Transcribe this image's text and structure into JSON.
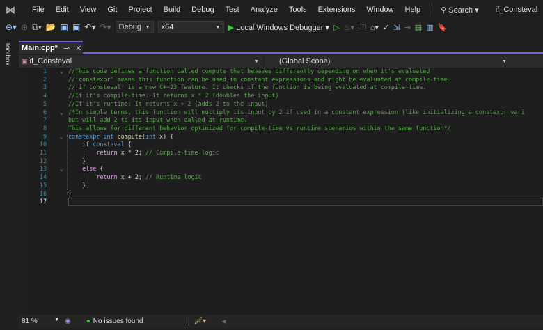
{
  "menu": {
    "items": [
      "File",
      "Edit",
      "View",
      "Git",
      "Project",
      "Build",
      "Debug",
      "Test",
      "Analyze",
      "Tools",
      "Extensions",
      "Window",
      "Help"
    ],
    "search": "Search",
    "solution": "if_Consteval"
  },
  "toolbar": {
    "config": "Debug",
    "platform": "x64",
    "debugger": "Local Windows Debugger"
  },
  "toolbox": {
    "label": "Toolbox"
  },
  "tab": {
    "label": "Main.cpp*"
  },
  "nav": {
    "project": "if_Consteval",
    "scope": "(Global Scope)"
  },
  "colors": {
    "comment": "#57a64a",
    "keyword": "#569cd6",
    "control": "#d8a0df",
    "function": "#dcdcaa",
    "plain": "#dcdcdc",
    "accent": "#7160e8"
  },
  "editor": {
    "current_line": 17,
    "lines": [
      {
        "n": "1",
        "fold": true,
        "tokens": [
          {
            "t": "//This code defines a function called compute that behaves differently depending on when it's evaluated",
            "c": "comment"
          }
        ]
      },
      {
        "n": "2",
        "tokens": [
          {
            "t": "//'constexpr' means this function can be used in constant expressions and might be evaluated at compile-time.",
            "c": "comment"
          }
        ]
      },
      {
        "n": "3",
        "tokens": [
          {
            "t": "//'if consteval' is a new C++23 feature. It checks if the function is being evaluated at compile-time.",
            "c": "comment"
          }
        ]
      },
      {
        "n": "4",
        "tokens": [
          {
            "t": "//If it's compile-time: It returns x * 2 (doubles the input)",
            "c": "comment"
          }
        ]
      },
      {
        "n": "5",
        "tokens": [
          {
            "t": "//If it's runtime: It returns x + 2 (adds 2 to the input)",
            "c": "comment"
          }
        ]
      },
      {
        "n": "6",
        "fold": true,
        "tokens": [
          {
            "t": "/*In simple terms, this function will multiply its input by 2 if used in a constant expression (like initializing a constexpr vari",
            "c": "comment"
          }
        ]
      },
      {
        "n": "7",
        "tokens": [
          {
            "t": "but will add 2 to its input when called at runtime.",
            "c": "comment"
          }
        ]
      },
      {
        "n": "8",
        "tokens": [
          {
            "t": "This allows for different behavior optimized for compile-time vs runtime scenarios within the same function*/",
            "c": "comment"
          }
        ]
      },
      {
        "n": "9",
        "fold": true,
        "tokens": [
          {
            "t": "constexpr int ",
            "c": "keyword"
          },
          {
            "t": "compute",
            "c": "function"
          },
          {
            "t": "(",
            "c": "plain"
          },
          {
            "t": "int",
            "c": "keyword"
          },
          {
            "t": " x) {",
            "c": "plain"
          }
        ]
      },
      {
        "n": "10",
        "tokens": [
          {
            "t": "    ",
            "c": "plain"
          },
          {
            "t": "if",
            "c": "control"
          },
          {
            "t": " consteval",
            "c": "keyword"
          },
          {
            "t": " {",
            "c": "plain"
          }
        ]
      },
      {
        "n": "11",
        "tokens": [
          {
            "t": "        ",
            "c": "plain"
          },
          {
            "t": "return",
            "c": "control"
          },
          {
            "t": " x * 2; ",
            "c": "plain"
          },
          {
            "t": "// Compile-time logic",
            "c": "comment"
          }
        ]
      },
      {
        "n": "12",
        "tokens": [
          {
            "t": "    }",
            "c": "plain"
          }
        ]
      },
      {
        "n": "13",
        "fold": true,
        "tokens": [
          {
            "t": "    ",
            "c": "plain"
          },
          {
            "t": "else",
            "c": "control"
          },
          {
            "t": " {",
            "c": "plain"
          }
        ]
      },
      {
        "n": "14",
        "tokens": [
          {
            "t": "        ",
            "c": "plain"
          },
          {
            "t": "return",
            "c": "control"
          },
          {
            "t": " x + 2; ",
            "c": "plain"
          },
          {
            "t": "// Runtime logic",
            "c": "comment"
          }
        ]
      },
      {
        "n": "15",
        "tokens": [
          {
            "t": "    }",
            "c": "plain"
          }
        ]
      },
      {
        "n": "16",
        "tokens": [
          {
            "t": "}",
            "c": "plain"
          }
        ]
      },
      {
        "n": "17",
        "tokens": []
      }
    ]
  },
  "status": {
    "zoom": "81 %",
    "issues": "No issues found"
  }
}
